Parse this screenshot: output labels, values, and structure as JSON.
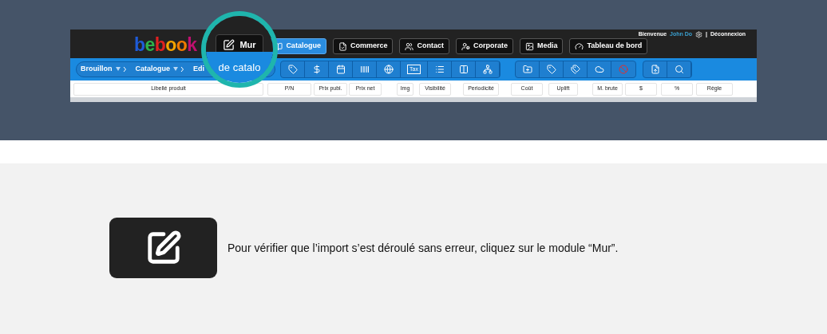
{
  "app_screenshot": {
    "logo": "bebook",
    "user_bar": {
      "greeting": "Bienvenue",
      "user": "John Do",
      "separator": "|",
      "logout": "Déconnexion"
    },
    "modules": [
      {
        "label": "Catalogue",
        "selected": true
      },
      {
        "label": "Commerce",
        "selected": false
      },
      {
        "label": "Contact",
        "selected": false
      },
      {
        "label": "Corporate",
        "selected": false
      },
      {
        "label": "Media",
        "selected": false
      },
      {
        "label": "Tableau de bord",
        "selected": false
      }
    ],
    "breadcrumb": [
      "Brouillon",
      "Catalogue",
      "Edi"
    ],
    "tax_label": "Tax",
    "columns": [
      "Libellé produit",
      "P/N",
      "Prix publ.",
      "Prix net",
      "Img",
      "Visibilité",
      "Periodicité",
      "Coût",
      "Uplift",
      "M. brute",
      "$",
      "%",
      "Règle"
    ],
    "magnifier": {
      "module": "Mur",
      "caption": "de catalo"
    }
  },
  "instruction": {
    "text": "Pour vérifier que l’import s’est déroulé sans erreur, cliquez sur le module “Mur”."
  }
}
